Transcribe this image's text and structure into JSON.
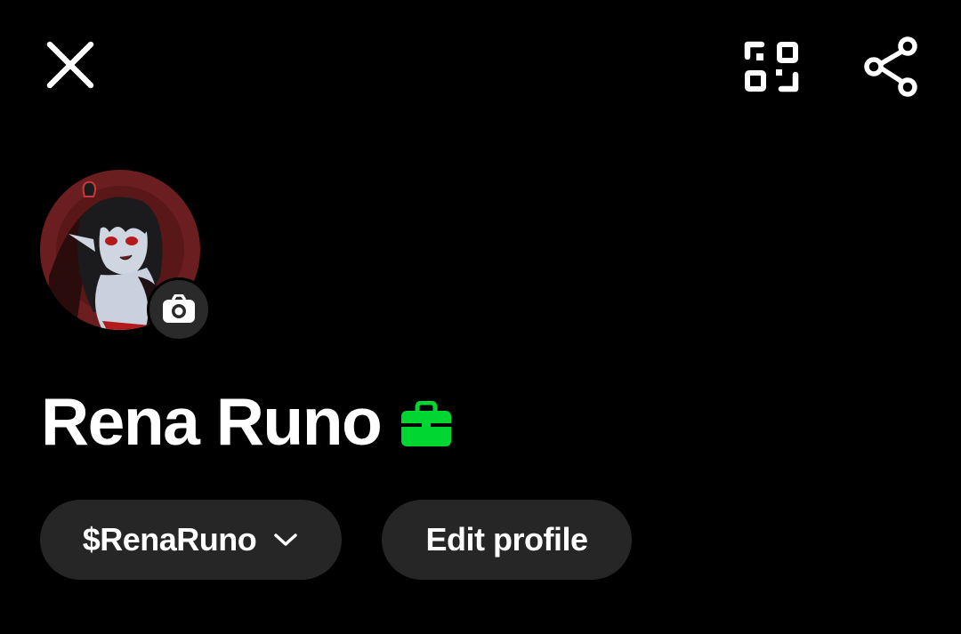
{
  "header": {
    "close_icon": "close-icon",
    "qr_icon": "qr-code-scan-icon",
    "share_icon": "share-icon"
  },
  "profile": {
    "display_name": "Rena Runo",
    "badge_icon": "briefcase-icon",
    "badge_color": "#00d632",
    "avatar_icon": "avatar-illustration",
    "camera_icon": "camera-icon"
  },
  "actions": {
    "cashtag_label": "$RenaRuno",
    "cashtag_dropdown_icon": "chevron-down-icon",
    "edit_profile_label": "Edit profile"
  },
  "colors": {
    "background": "#000000",
    "text": "#ffffff",
    "pill_background": "#262626",
    "accent_green": "#00d632"
  }
}
